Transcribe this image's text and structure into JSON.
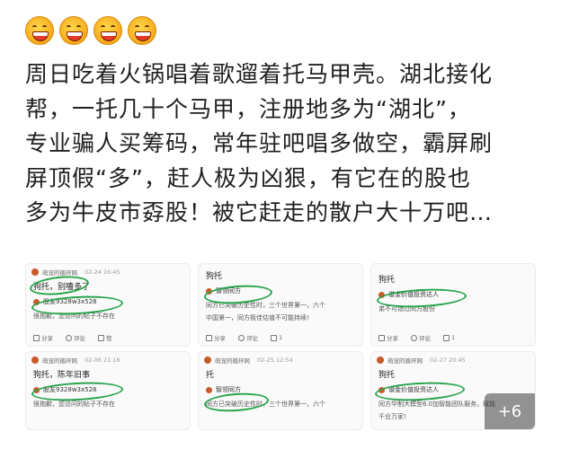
{
  "emojis": [
    "grinning-face",
    "grinning-face",
    "grinning-face",
    "grinning-face"
  ],
  "post": {
    "lines": [
      "周日吃着火锅唱着歌遛着托马甲壳。湖北接化",
      "帮，一托几十个马甲，注册地多为“湖北”，",
      "专业骗人买筹码，常年驻吧唱多做空，霸屏刷",
      "屏顶假“多”，赶人极为凶狠，有它在的股也",
      "多为牛皮市孬股！被它赶走的散户大十万吧…"
    ]
  },
  "cards": {
    "c1": {
      "user": "萌宠的循环网",
      "time": "02-24 16:45",
      "title": "狗托，别嗑多了",
      "quoted": "股友9328w3x528",
      "body": "很抱歉，您访问的帖子不存在",
      "share": "分享",
      "comment": "评论",
      "like": "赞"
    },
    "c2": {
      "user": "萌宠的循环网",
      "time": "02-06 21:16",
      "title": "狗托，陈年旧事",
      "quoted": "股友9328w3x528",
      "body": "很抱歉，您访问的帖子不存在"
    },
    "c3": {
      "title": "狗托",
      "quoted": "智领同方",
      "body1": "同方已突破历史性时，三个世界第一，六个",
      "body2": "中国第一，同方极佳估值不可能持续!",
      "share": "分享",
      "comment": "评论",
      "like": "1"
    },
    "c4": {
      "user": "萌宠的循环网",
      "time": "02-25 12:54",
      "title": "托",
      "quoted": "智领同方",
      "body1": "同方已突破历史性时，三个世界第一，六个"
    },
    "c5": {
      "title": "狗托",
      "quoted": "谱金价值投资达人",
      "body": "弟不可错过同方股份",
      "share": "分享",
      "comment": "评论",
      "like": "1"
    },
    "c6": {
      "user": "萌宠的循环网",
      "time": "02-27 20:45",
      "title": "狗托",
      "quoted": "谱金价值投资达人",
      "body1": "同方华制大模型6.0加智能团队服务，赋能",
      "body2": "千业万家!",
      "more": "+6"
    }
  }
}
